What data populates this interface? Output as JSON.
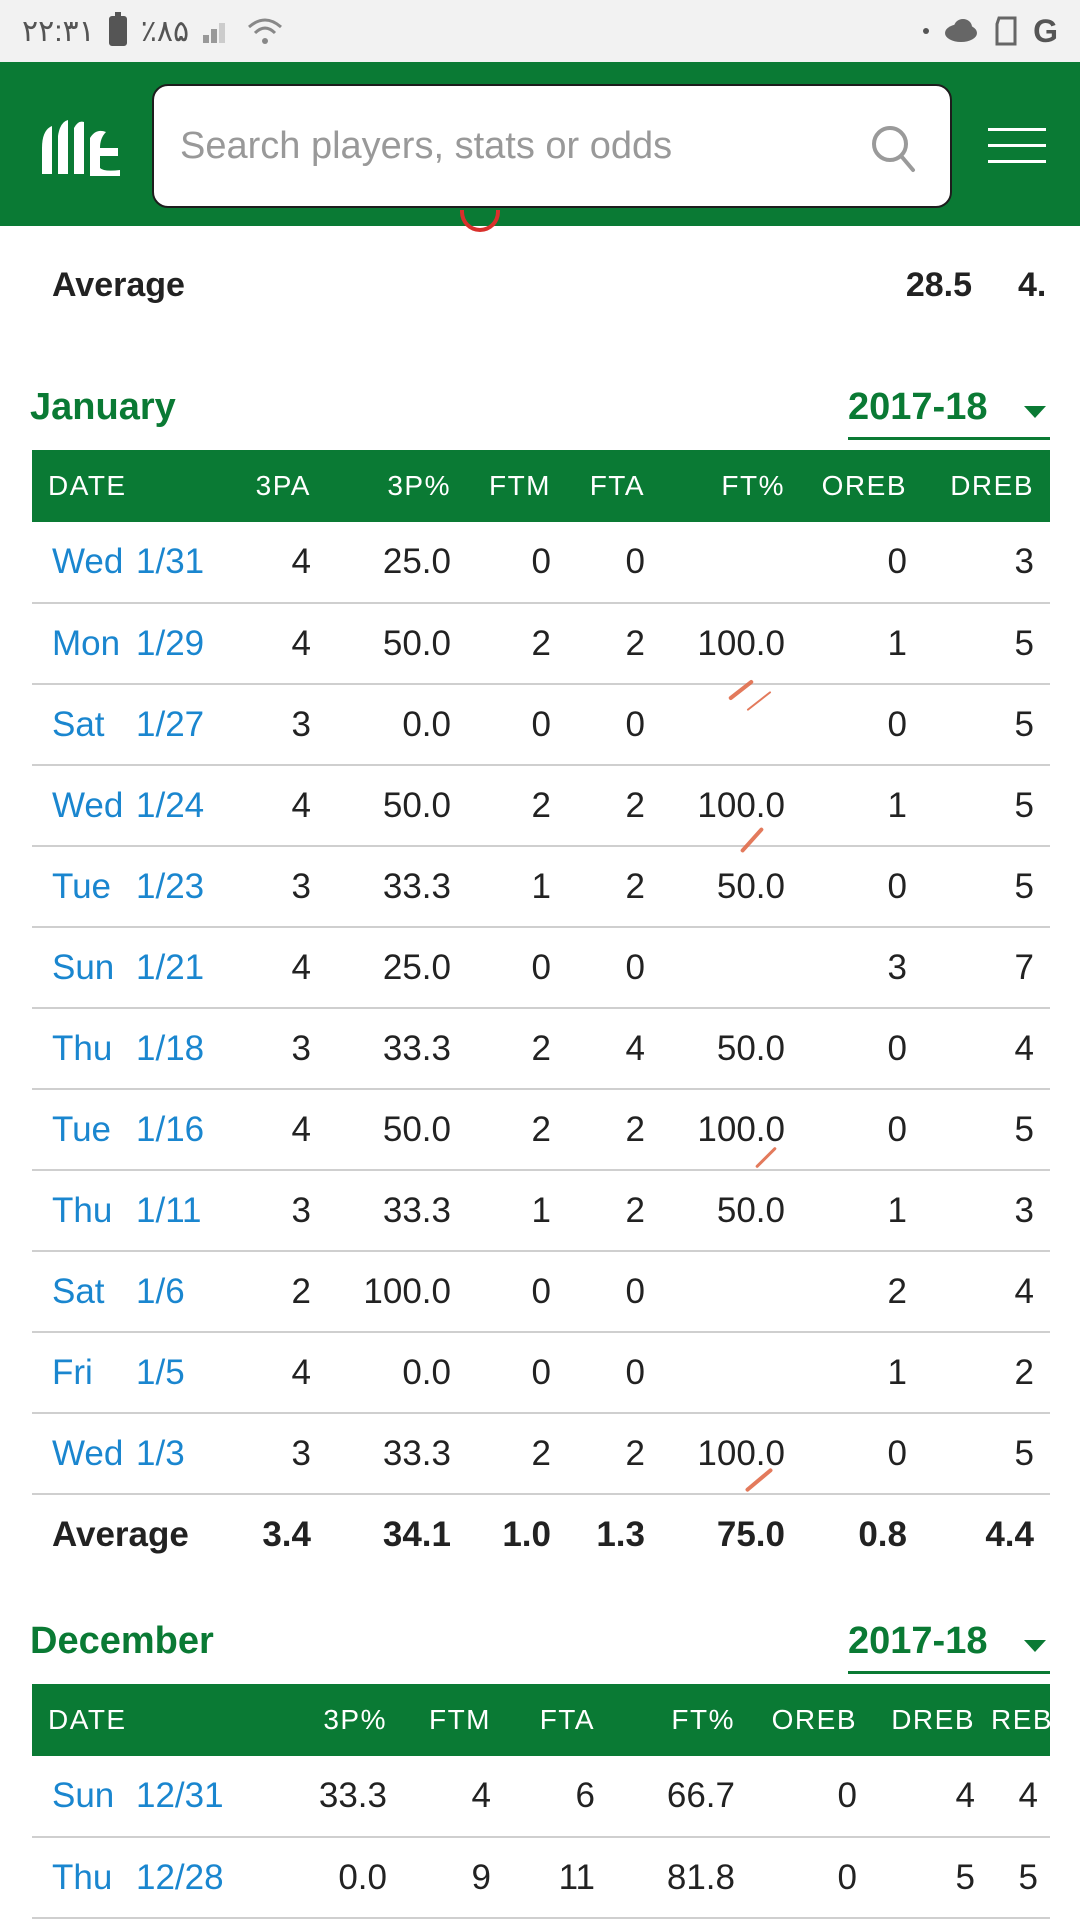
{
  "status_bar": {
    "time": "۲۲:۳۱",
    "battery": "٪۸۵",
    "right_icons": [
      "dot-icon",
      "cloud-icon",
      "sim-card-icon",
      "google-icon"
    ]
  },
  "header": {
    "search_placeholder": "Search players, stats or odds",
    "logo_icon": "bballref-logo-icon",
    "menu_icon": "hamburger-menu-icon"
  },
  "top_average": {
    "label": "Average",
    "value_1": "28.5",
    "value_2": "4."
  },
  "january": {
    "title": "January",
    "season": "2017-18",
    "columns": [
      "DATE",
      "3PA",
      "3P%",
      "FTM",
      "FTA",
      "FT%",
      "OREB",
      "DREB"
    ],
    "rows": [
      {
        "dow": "Wed",
        "date": "1/31",
        "cells": [
          "4",
          "25.0",
          "0",
          "0",
          "",
          "0",
          "3"
        ]
      },
      {
        "dow": "Mon",
        "date": "1/29",
        "cells": [
          "4",
          "50.0",
          "2",
          "2",
          "100.0",
          "1",
          "5"
        ]
      },
      {
        "dow": "Sat",
        "date": "1/27",
        "cells": [
          "3",
          "0.0",
          "0",
          "0",
          "",
          "0",
          "5"
        ]
      },
      {
        "dow": "Wed",
        "date": "1/24",
        "cells": [
          "4",
          "50.0",
          "2",
          "2",
          "100.0",
          "1",
          "5"
        ]
      },
      {
        "dow": "Tue",
        "date": "1/23",
        "cells": [
          "3",
          "33.3",
          "1",
          "2",
          "50.0",
          "0",
          "5"
        ]
      },
      {
        "dow": "Sun",
        "date": "1/21",
        "cells": [
          "4",
          "25.0",
          "0",
          "0",
          "",
          "3",
          "7"
        ]
      },
      {
        "dow": "Thu",
        "date": "1/18",
        "cells": [
          "3",
          "33.3",
          "2",
          "4",
          "50.0",
          "0",
          "4"
        ]
      },
      {
        "dow": "Tue",
        "date": "1/16",
        "cells": [
          "4",
          "50.0",
          "2",
          "2",
          "100.0",
          "0",
          "5"
        ]
      },
      {
        "dow": "Thu",
        "date": "1/11",
        "cells": [
          "3",
          "33.3",
          "1",
          "2",
          "50.0",
          "1",
          "3"
        ]
      },
      {
        "dow": "Sat",
        "date": "1/6",
        "cells": [
          "2",
          "100.0",
          "0",
          "0",
          "",
          "2",
          "4"
        ]
      },
      {
        "dow": "Fri",
        "date": "1/5",
        "cells": [
          "4",
          "0.0",
          "0",
          "0",
          "",
          "1",
          "2"
        ]
      },
      {
        "dow": "Wed",
        "date": "1/3",
        "cells": [
          "3",
          "33.3",
          "2",
          "2",
          "100.0",
          "0",
          "5"
        ]
      }
    ],
    "average": {
      "label": "Average",
      "cells": [
        "3.4",
        "34.1",
        "1.0",
        "1.3",
        "75.0",
        "0.8",
        "4.4"
      ]
    }
  },
  "december": {
    "title": "December",
    "season": "2017-18",
    "columns": [
      "DATE",
      "3P%",
      "FTM",
      "FTA",
      "FT%",
      "OREB",
      "DREB",
      "REB"
    ],
    "rows": [
      {
        "dow": "Sun",
        "date": "12/31",
        "cells": [
          "33.3",
          "4",
          "6",
          "66.7",
          "0",
          "4",
          "4"
        ]
      },
      {
        "dow": "Thu",
        "date": "12/28",
        "cells": [
          "0.0",
          "9",
          "11",
          "81.8",
          "0",
          "5",
          "5"
        ]
      }
    ]
  },
  "colors": {
    "brand_green": "#0a7a34",
    "link_blue": "#1a86cf",
    "row_divider": "#cfcfcf"
  }
}
